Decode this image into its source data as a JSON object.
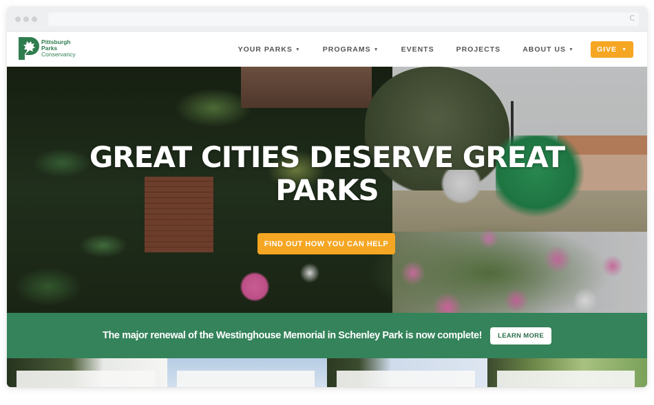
{
  "browser": {
    "reload_icon": "reload-icon"
  },
  "header": {
    "logo": {
      "line1": "Pittsburgh",
      "line2": "Parks",
      "line3": "Conservancy",
      "icon": "leaf-p-logo-icon"
    },
    "nav": [
      {
        "label": "YOUR PARKS",
        "has_dropdown": true
      },
      {
        "label": "PROGRAMS",
        "has_dropdown": true
      },
      {
        "label": "EVENTS",
        "has_dropdown": false
      },
      {
        "label": "PROJECTS",
        "has_dropdown": false
      },
      {
        "label": "ABOUT US",
        "has_dropdown": true
      }
    ],
    "give_label": "GIVE",
    "caret": "▼"
  },
  "hero": {
    "title_line1": "GREAT CITIES DESERVE GREAT",
    "title_line2": "PARKS",
    "cta_label": "FIND OUT HOW YOU CAN HELP"
  },
  "announcement": {
    "text": "The major renewal of the Westinghouse Memorial in Schenley Park is now complete!",
    "button_label": "LEARN MORE"
  },
  "colors": {
    "brand_green": "#2f7d4f",
    "banner_green": "#34835a",
    "accent_orange": "#f5a623"
  }
}
